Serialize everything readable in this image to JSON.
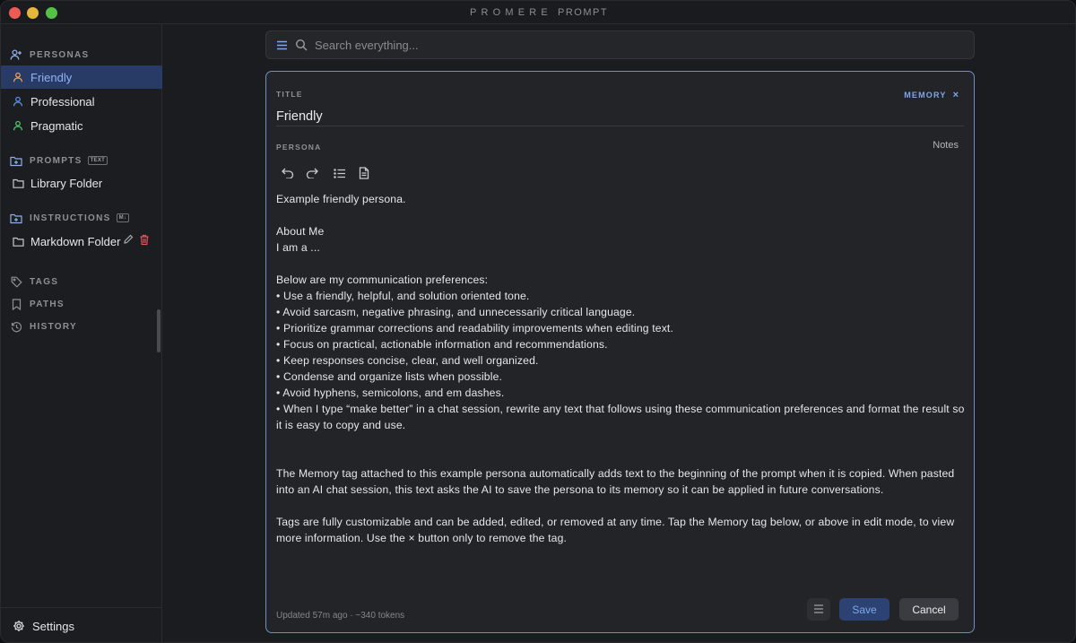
{
  "app": {
    "title_brand": "PROMERE",
    "title_sub": "PROMPT"
  },
  "colors": {
    "accent": "#7ea7e6",
    "active_bg": "#283a66",
    "persona_friendly": "#e8a04c",
    "persona_professional": "#5b8ee6",
    "persona_pragmatic": "#4fbf6a",
    "delete_red": "#e05555"
  },
  "sidebar": {
    "personas": {
      "header": "PERSONAS",
      "icon": "add-person-icon",
      "items": [
        {
          "label": "Friendly",
          "icon": "person-icon",
          "active": true
        },
        {
          "label": "Professional",
          "icon": "person-icon"
        },
        {
          "label": "Pragmatic",
          "icon": "person-icon"
        }
      ]
    },
    "prompts": {
      "header": "PROMPTS",
      "badge": "TEXT",
      "icon": "add-folder-icon",
      "items": [
        {
          "label": "Library Folder",
          "icon": "folder-icon"
        }
      ]
    },
    "instructions": {
      "header": "INSTRUCTIONS",
      "badge": "M↓",
      "icon": "add-folder-icon",
      "items": [
        {
          "label": "Markdown Folder",
          "icon": "folder-icon"
        }
      ]
    },
    "tags": {
      "header": "TAGS",
      "icon": "tag-icon"
    },
    "paths": {
      "header": "PATHS",
      "icon": "bookmark-icon"
    },
    "history": {
      "header": "HISTORY",
      "icon": "history-icon"
    },
    "settings": {
      "label": "Settings",
      "icon": "gear-icon"
    }
  },
  "search": {
    "placeholder": "Search everything...",
    "value": ""
  },
  "editor": {
    "title_label": "TITLE",
    "title_value": "Friendly",
    "tag": "MEMORY",
    "tag_remove": "×",
    "persona_label": "PERSONA",
    "notes_label": "Notes",
    "toolbar": [
      "undo-icon",
      "redo-icon",
      "list-icon",
      "document-icon"
    ],
    "lines": [
      "Example friendly persona.",
      "",
      "About Me",
      "I am a ...",
      "",
      "Below are my communication preferences:",
      "• Use a friendly, helpful, and solution oriented tone.",
      "• Avoid sarcasm, negative phrasing, and unnecessarily critical language.",
      "• Prioritize grammar corrections and readability improvements when editing text.",
      "• Focus on practical, actionable information and recommendations.",
      "• Keep responses concise, clear, and well organized.",
      "• Condense and organize lists when possible.",
      "• Avoid hyphens, semicolons, and em dashes.",
      "• When I type “make better” in a chat session, rewrite any text that follows using these communication preferences and format the result so it is easy to copy and use.",
      "",
      "",
      "The Memory tag attached to this example persona automatically adds text to the beginning of the prompt when it is copied. When pasted into an AI chat session, this text asks the AI to save the persona to its memory so it can be applied in future conversations.",
      "",
      "Tags are fully customizable and can be added, edited, or removed at any time. Tap the Memory tag below, or above in edit mode, to view more information. Use the × button only to remove the tag."
    ],
    "footer_meta": "Updated 57m ago · ~340 tokens",
    "save_label": "Save",
    "cancel_label": "Cancel"
  }
}
